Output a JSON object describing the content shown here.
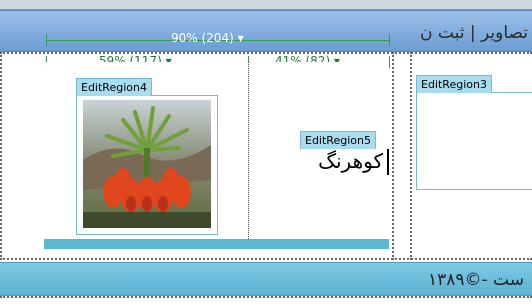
{
  "header": {
    "title": "تصاویر | ثبت ن"
  },
  "guides": {
    "full_width": "90% (204) ▾",
    "left_col": "59% (117) ▾",
    "right_col": "41% (82) ▾"
  },
  "regions": {
    "region4_label": "EditRegion4",
    "region5_label": "EditRegion5",
    "region5_text": "کوهرنگ",
    "region3_label": "EditRegion3"
  },
  "footer": {
    "text": "ست -©۱۳۸۹"
  },
  "colors": {
    "header_blue": "#6c9cd4",
    "footer_cyan": "#5db3d4",
    "guide_green": "#2e9d4c",
    "region_tag_bg": "#a8ddf0"
  }
}
